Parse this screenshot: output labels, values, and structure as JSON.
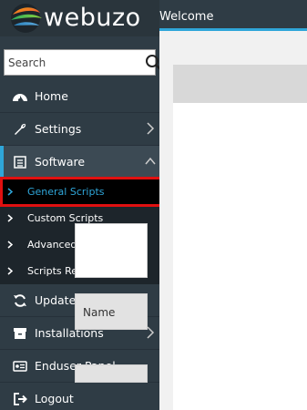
{
  "brand": {
    "name": "webuzo",
    "logo_icon": "webuzo-swirl-logo"
  },
  "topbar": {
    "title": "Welcome"
  },
  "search": {
    "placeholder": "Search",
    "icon": "search-icon"
  },
  "menu": {
    "items": [
      {
        "label": "Home",
        "icon": "dashboard-icon",
        "has_chevron": false
      },
      {
        "label": "Settings",
        "icon": "wrench-icon",
        "has_chevron": true
      },
      {
        "label": "Software",
        "icon": "list-icon",
        "has_chevron": true,
        "expanded": true
      },
      {
        "label": "Updates",
        "icon": "refresh-icon",
        "has_chevron": false
      },
      {
        "label": "Installations",
        "icon": "box-icon",
        "has_chevron": true
      },
      {
        "label": "Enduser Panel",
        "icon": "panel-icon",
        "has_chevron": false
      },
      {
        "label": "Logout",
        "icon": "logout-icon",
        "has_chevron": false
      }
    ],
    "software_sub": [
      {
        "label": "General Scripts",
        "selected": true
      },
      {
        "label": "Custom Scripts"
      },
      {
        "label": "Advanced Settings"
      },
      {
        "label": "Scripts Requirements"
      }
    ]
  },
  "main": {
    "name_header": "Name"
  },
  "colors": {
    "sidebar": "#2f3c45",
    "accent": "#2fa6d9",
    "highlight": "#e01010"
  }
}
